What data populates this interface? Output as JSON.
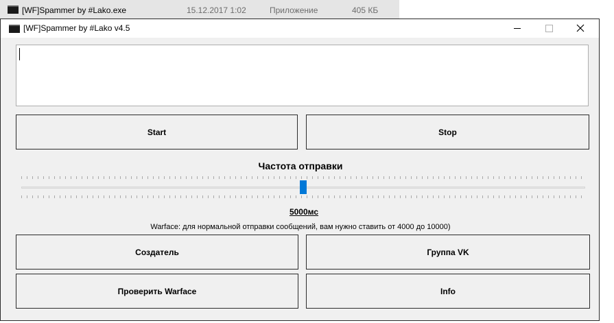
{
  "explorer_row": {
    "file_name": "[WF]Spammer by #Lako.exe",
    "date": "15.12.2017 1:02",
    "type": "Приложение",
    "size": "405 КБ"
  },
  "window": {
    "title": "[WF]Spammer by #Lako v4.5",
    "icon": "app-window-icon",
    "controls": [
      "minimize",
      "maximize",
      "close"
    ]
  },
  "message_box": {
    "value": ""
  },
  "buttons": {
    "start": "Start",
    "stop": "Stop",
    "creator": "Создатель",
    "vk_group": "Группа VK",
    "check_warface": "Проверить Warface",
    "info": "Info"
  },
  "frequency": {
    "title": "Частота отправки",
    "value_label": "5000мс",
    "slider_position": 0.5,
    "hint": "Warface: для нормальной отправки сообщений, вам нужно ставить от 4000 до 10000)"
  },
  "colors": {
    "accent": "#0078d7",
    "window_bg": "#f0f0f0"
  }
}
